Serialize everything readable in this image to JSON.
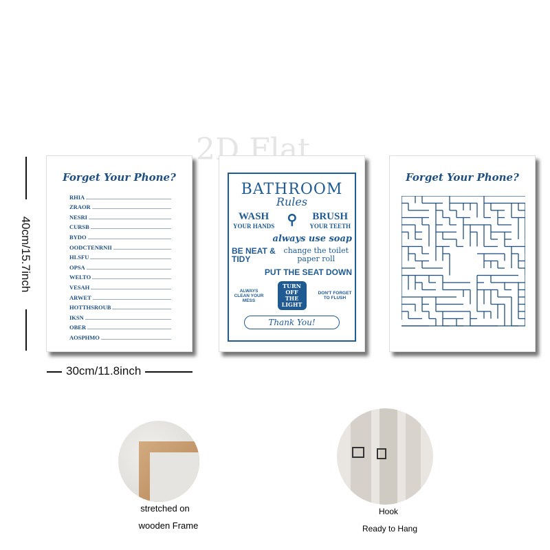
{
  "watermark": "2D Flat",
  "dimensions": {
    "height": "40cm/15.7inch",
    "width": "30cm/11.8inch"
  },
  "poster_left": {
    "title": "Forget Your Phone?",
    "words": [
      "RHIA",
      "ZRAOR",
      "NESRI",
      "CURSB",
      "BYDO",
      "OODCTENRNII",
      "HLSFU",
      "OPSA",
      "WELTO",
      "VESAH",
      "ARWET",
      "HOTTHSROUB",
      "IKSN",
      "OBER",
      "AOSPHMO"
    ]
  },
  "poster_middle": {
    "title": "BATHROOM",
    "subtitle": "Rules",
    "wash": "WASH",
    "your_hands": "YOUR HANDS",
    "brush": "BRUSH",
    "your_teeth": "YOUR TEETH",
    "soap": "always use soap",
    "neat": "BE NEAT & TIDY",
    "paper": "change the toilet paper roll",
    "seat": "PUT THE SEAT DOWN",
    "clean": "ALWAYS CLEAN YOUR MESS",
    "light": "TURN OFF THE LIGHT",
    "flush": "DON'T FORGET TO FLUSH",
    "thanks": "Thank You!"
  },
  "poster_right": {
    "title": "Forget Your Phone?"
  },
  "features": [
    {
      "line1": "stretched on",
      "line2": "wooden Frame"
    },
    {
      "line1": "Hook",
      "line2": "Ready to Hang"
    }
  ],
  "colors": {
    "ink": "#1f4f80"
  }
}
